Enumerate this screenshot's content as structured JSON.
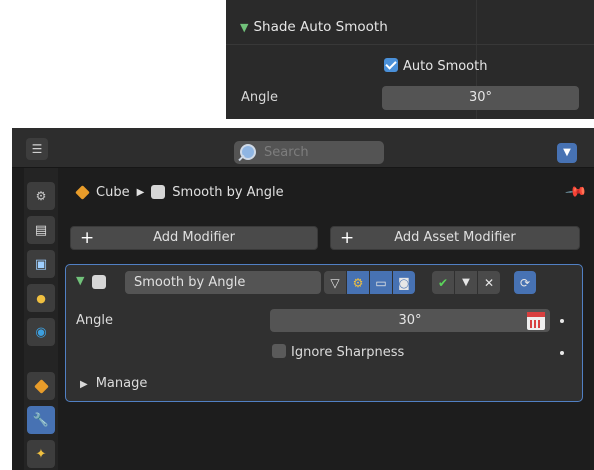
{
  "top_panel": {
    "section_title": "Shade Auto Smooth",
    "checkbox_label": "Auto Smooth",
    "checkbox_checked": true,
    "angle_label": "Angle",
    "angle_value": "30°"
  },
  "properties": {
    "search_placeholder": "Search",
    "breadcrumb": {
      "object": "Cube",
      "modifier": "Smooth by Angle"
    },
    "add_modifier_label": "Add Modifier",
    "add_asset_modifier_label": "Add Asset Modifier",
    "modifier": {
      "name": "Smooth by Angle",
      "angle_label": "Angle",
      "angle_value": "30°",
      "ignore_sharpness_label": "Ignore Sharpness",
      "ignore_sharpness_checked": false,
      "manage_label": "Manage"
    },
    "sidebar_tabs": [
      "tool",
      "render",
      "output",
      "view-layer",
      "scene",
      "world",
      "object",
      "modifiers",
      "particles"
    ],
    "active_tab": "modifiers"
  },
  "colors": {
    "accent_blue": "#4772b3",
    "panel_outline": "#5180c4",
    "expand_green": "#71c27a",
    "object_orange": "#e89c2a"
  }
}
